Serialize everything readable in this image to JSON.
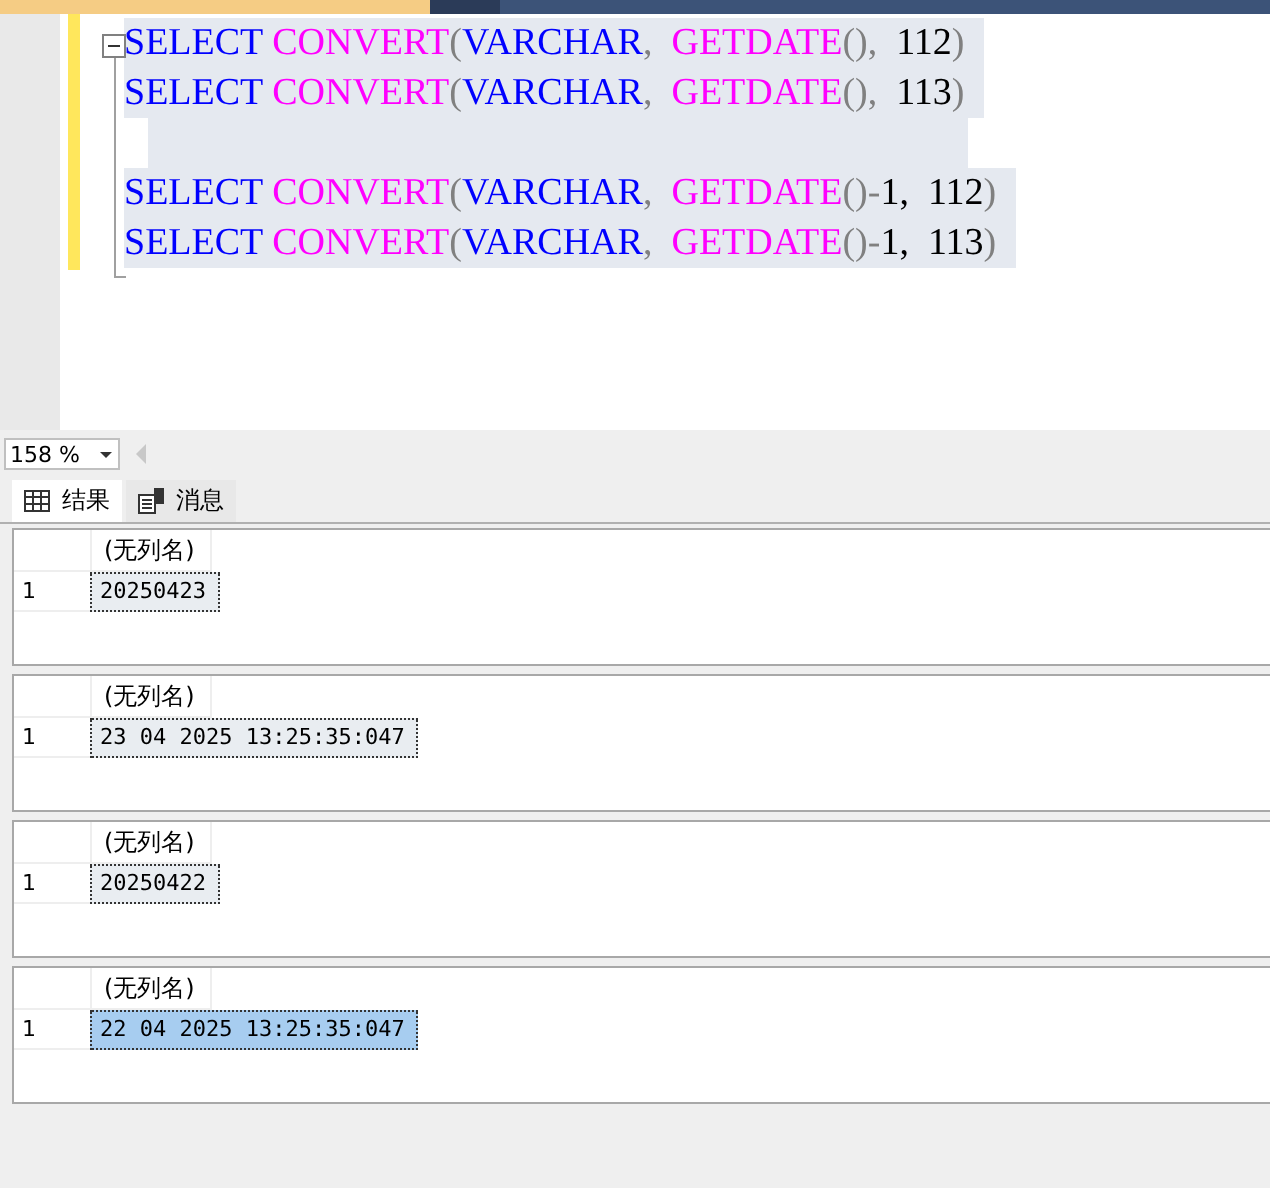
{
  "editor": {
    "lines": [
      {
        "kind": "code",
        "selected": true,
        "tokens": [
          {
            "text": "SELECT ",
            "kind": "keyword"
          },
          {
            "text": "CONVERT",
            "kind": "function"
          },
          {
            "text": "(",
            "kind": "punct"
          },
          {
            "text": "VARCHAR",
            "kind": "keyword"
          },
          {
            "text": ",  ",
            "kind": "punct"
          },
          {
            "text": "GETDATE",
            "kind": "function"
          },
          {
            "text": "(),  ",
            "kind": "punct"
          },
          {
            "text": "112",
            "kind": "number"
          },
          {
            "text": ")",
            "kind": "punct"
          }
        ]
      },
      {
        "kind": "code",
        "selected": true,
        "tokens": [
          {
            "text": "SELECT ",
            "kind": "keyword"
          },
          {
            "text": "CONVERT",
            "kind": "function"
          },
          {
            "text": "(",
            "kind": "punct"
          },
          {
            "text": "VARCHAR",
            "kind": "keyword"
          },
          {
            "text": ",  ",
            "kind": "punct"
          },
          {
            "text": "GETDATE",
            "kind": "function"
          },
          {
            "text": "(),  ",
            "kind": "punct"
          },
          {
            "text": "113",
            "kind": "number"
          },
          {
            "text": ")",
            "kind": "punct"
          }
        ]
      },
      {
        "kind": "blank",
        "selected": true
      },
      {
        "kind": "code",
        "selected": true,
        "tokens": [
          {
            "text": "SELECT ",
            "kind": "keyword"
          },
          {
            "text": "CONVERT",
            "kind": "function"
          },
          {
            "text": "(",
            "kind": "punct"
          },
          {
            "text": "VARCHAR",
            "kind": "keyword"
          },
          {
            "text": ",  ",
            "kind": "punct"
          },
          {
            "text": "GETDATE",
            "kind": "function"
          },
          {
            "text": "()",
            "kind": "punct"
          },
          {
            "text": "-",
            "kind": "punct"
          },
          {
            "text": "1,  ",
            "kind": "number"
          },
          {
            "text": "112",
            "kind": "number"
          },
          {
            "text": ")",
            "kind": "punct"
          }
        ]
      },
      {
        "kind": "code",
        "selected": true,
        "tokens": [
          {
            "text": "SELECT ",
            "kind": "keyword"
          },
          {
            "text": "CONVERT",
            "kind": "function"
          },
          {
            "text": "(",
            "kind": "punct"
          },
          {
            "text": "VARCHAR",
            "kind": "keyword"
          },
          {
            "text": ",  ",
            "kind": "punct"
          },
          {
            "text": "GETDATE",
            "kind": "function"
          },
          {
            "text": "()",
            "kind": "punct"
          },
          {
            "text": "-",
            "kind": "punct"
          },
          {
            "text": "1,  ",
            "kind": "number"
          },
          {
            "text": "113",
            "kind": "number"
          },
          {
            "text": ")",
            "kind": "punct"
          }
        ]
      }
    ]
  },
  "zoom": {
    "value": "158 %"
  },
  "tabs": [
    {
      "label": "结果",
      "kind": "results",
      "selected": true
    },
    {
      "label": "消息",
      "kind": "messages",
      "selected": false
    }
  ],
  "results": [
    {
      "header": "(无列名)",
      "row": "1",
      "value": "20250423",
      "selected": false
    },
    {
      "header": "(无列名)",
      "row": "1",
      "value": "23 04 2025 13:25:35:047",
      "selected": false
    },
    {
      "header": "(无列名)",
      "row": "1",
      "value": "20250422",
      "selected": false
    },
    {
      "header": "(无列名)",
      "row": "1",
      "value": "22 04 2025 13:25:35:047",
      "selected": true
    }
  ]
}
